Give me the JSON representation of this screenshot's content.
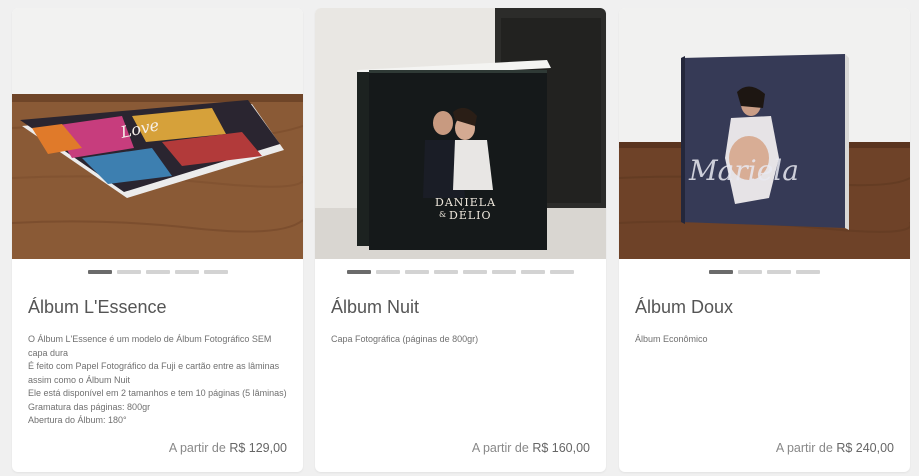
{
  "cards": [
    {
      "title": "Álbum L'Essence",
      "description": [
        "O Álbum L'Essence é um modelo de Álbum Fotográfico SEM capa dura",
        "É feito com Papel Fotográfico da Fuji e cartão entre as lâminas assim como o Álbum Nuit",
        "Ele está disponível em 2 tamanhos e tem 10 páginas (5 lâminas)",
        "Gramatura das páginas: 800gr",
        "Abertura do Álbum: 180°"
      ],
      "price_prefix": "A partir de",
      "price": "R$ 129,00",
      "carousel": {
        "total": 5,
        "active": 0
      },
      "image_icon": "photo-album-lessence"
    },
    {
      "title": "Álbum Nuit",
      "description": [
        "Capa Fotográfica (páginas de 800gr)"
      ],
      "price_prefix": "A partir de",
      "price": "R$ 160,00",
      "carousel": {
        "total": 8,
        "active": 0
      },
      "cover_text": {
        "line1": "DANIELA",
        "amp": "&",
        "line2": "DÉLIO"
      },
      "image_icon": "photo-album-nuit"
    },
    {
      "title": "Álbum Doux",
      "description": [
        "Álbum Econômico"
      ],
      "price_prefix": "A partir de",
      "price": "R$ 240,00",
      "carousel": {
        "total": 4,
        "active": 0
      },
      "cover_text": {
        "script": "Mariela"
      },
      "image_icon": "photo-album-doux"
    }
  ],
  "colors": {
    "background": "#f0f0f0",
    "card": "#ffffff",
    "dot_active": "#6b6b6b",
    "dot_inactive": "#d3d3d3"
  }
}
